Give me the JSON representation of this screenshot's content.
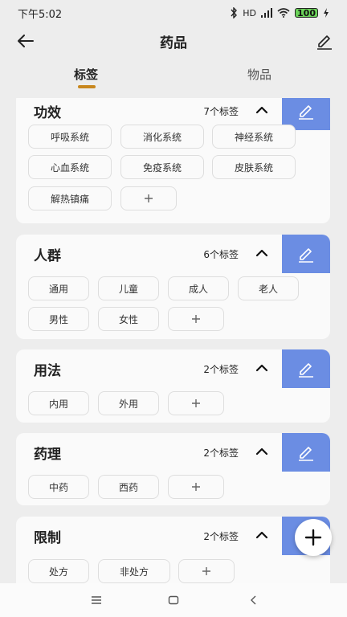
{
  "status_bar": {
    "time": "下午5:02",
    "network_label": "HD",
    "battery": "100"
  },
  "header": {
    "title": "药品"
  },
  "tabs": [
    {
      "label": "标签",
      "active": true
    },
    {
      "label": "物品",
      "active": false
    }
  ],
  "accent_colors": {
    "edit_panel": "#6b8de3",
    "tab_indicator": "#c8871e"
  },
  "categories": [
    {
      "title": "功效",
      "count_label": "7个标签",
      "tags": [
        "呼吸系统",
        "消化系统",
        "神经系统",
        "心血系统",
        "免疫系统",
        "皮肤系统",
        "解热镇痛"
      ]
    },
    {
      "title": "人群",
      "count_label": "6个标签",
      "tags": [
        "通用",
        "儿童",
        "成人",
        "老人",
        "男性",
        "女性"
      ]
    },
    {
      "title": "用法",
      "count_label": "2个标签",
      "tags": [
        "内用",
        "外用"
      ]
    },
    {
      "title": "药理",
      "count_label": "2个标签",
      "tags": [
        "中药",
        "西药"
      ]
    },
    {
      "title": "限制",
      "count_label": "2个标签",
      "tags": [
        "处方",
        "非处方"
      ]
    }
  ],
  "icons": {
    "back": "arrow-left-icon",
    "edit": "pencil-icon",
    "collapse": "chevron-up-icon",
    "add": "plus-icon",
    "nav_menu": "menu-icon",
    "nav_home": "square-icon",
    "nav_back": "chevron-left-icon"
  }
}
